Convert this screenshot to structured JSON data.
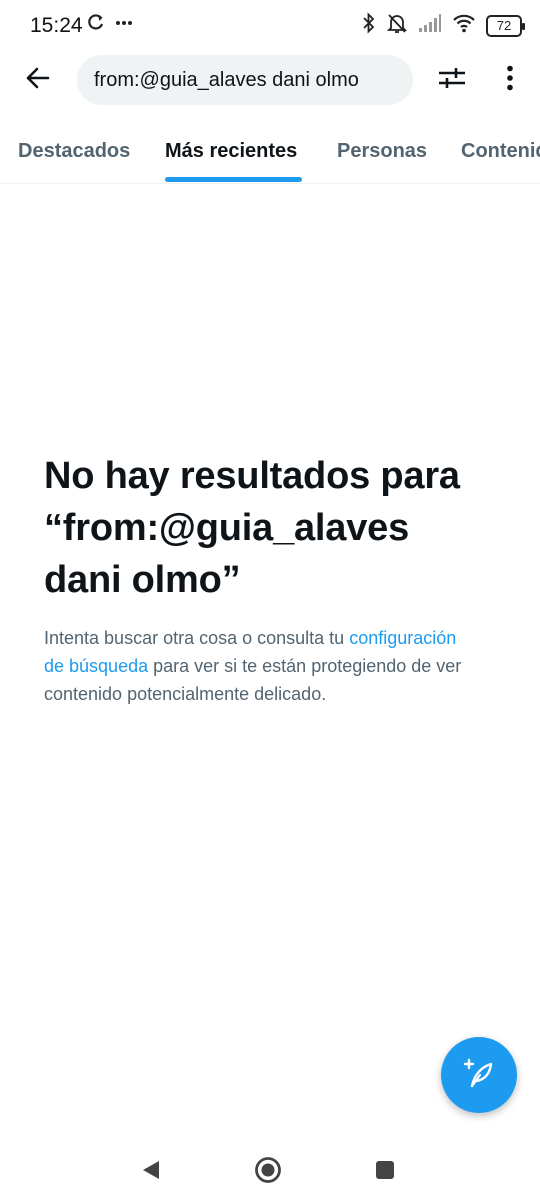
{
  "status_bar": {
    "time": "15:24",
    "battery_level": "72",
    "icons": [
      "sync-icon",
      "more-notifications-icon",
      "bluetooth-icon",
      "muted-bell-icon",
      "signal-icon",
      "wifi-icon",
      "battery-icon"
    ]
  },
  "header": {
    "search_value": "from:@guia_alaves dani olmo",
    "icons": [
      "back-arrow-icon",
      "filter-sliders-icon",
      "more-vertical-icon"
    ]
  },
  "tabs": [
    {
      "label": "Destacados",
      "active": false
    },
    {
      "label": "Más recientes",
      "active": true
    },
    {
      "label": "Personas",
      "active": false
    },
    {
      "label": "Contenido multimedia",
      "active": false
    }
  ],
  "empty_state": {
    "title": "No hay resultados para “from:@guia_alaves dani olmo”",
    "body_before": "Intenta buscar otra cosa o consulta tu ",
    "body_link": "configuración de búsqueda",
    "body_after": " para ver si te están protegiendo de ver contenido potencialmente delicado."
  },
  "fab": {
    "icon": "compose-post-icon"
  },
  "colors": {
    "accent": "#1d9bf0",
    "text_primary": "#0f1419",
    "text_secondary": "#536471",
    "search_bg": "#eff3f4"
  },
  "nav_bar": {
    "icons": [
      "nav-back-icon",
      "nav-home-icon",
      "nav-recents-icon"
    ]
  }
}
